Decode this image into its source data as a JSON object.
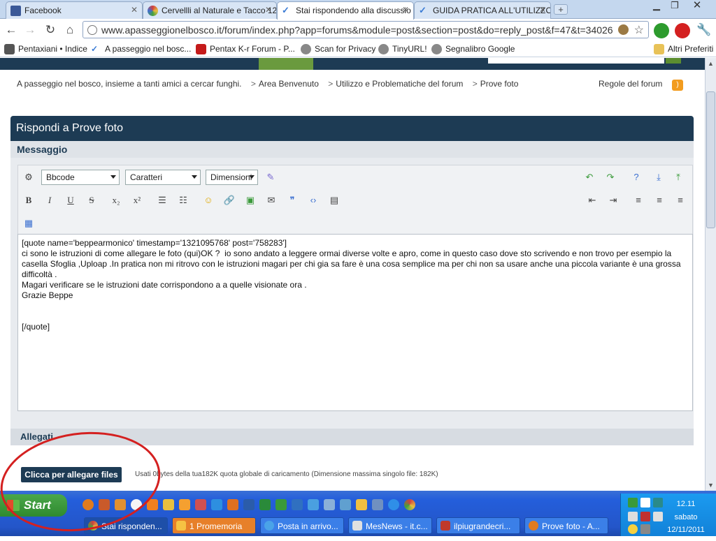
{
  "browser": {
    "tabs": [
      {
        "label": "Facebook",
        "color": "#3b5998"
      },
      {
        "label": "Cervellli al Naturale e Tacco 12",
        "color": "#d04040"
      },
      {
        "label": "Stai rispondendo alla discussio",
        "color": "#3a7bd5"
      },
      {
        "label": "GUIDA PRATICA ALL'UTILIZZO",
        "color": "#3a7bd5"
      }
    ],
    "url": "www.apasseggionelbosco.it/forum/index.php?app=forums&module=post&section=post&do=reply_post&f=47&t=34026",
    "bookmarks": [
      {
        "label": "Pentaxiani • Indice"
      },
      {
        "label": "A passeggio nel bosc..."
      },
      {
        "label": "Pentax K-r Forum - P..."
      },
      {
        "label": "Scan for Privacy"
      },
      {
        "label": "TinyURL!"
      },
      {
        "label": "Segnalibro Google"
      }
    ],
    "other_bookmarks": "Altri Preferiti"
  },
  "page": {
    "breadcrumbs": [
      "A passeggio nel bosco, insieme a tanti amici a cercar funghi.",
      "Area Benvenuto",
      "Utilizzo e Problematiche del forum",
      "Prove foto"
    ],
    "rules_link": "Regole del forum",
    "panel_title": "Rispondi a Prove foto",
    "section_title": "Messaggio",
    "editor": {
      "format_select": "Bbcode",
      "font_select": "Caratteri",
      "size_select": "Dimensioni",
      "content": "[quote name='beppearmonico' timestamp='1321095768' post='758283']\nci sono le istruzioni di come allegare le foto (qui)OK ?  io sono andato a leggere ormai diverse volte e apro, come in questo caso dove sto scrivendo e non trovo per esempio la casella Sfoglia ,Uploap .In pratica non mi ritrovo con le istruzioni magari per chi gia sa fare è una cosa semplice ma per chi non sa usare anche una piccola variante è una grossa difficoltà .\nMagari verificare se le istruzioni date corrispondono a a quelle visionate ora .\nGrazie Beppe\n\n\n[/quote]"
    },
    "attachments": {
      "title": "Allegati",
      "button": "Clicca per allegare files",
      "info": "Usati 0bytes della tua182K quota globale di caricamento (Dimensione massima singolo file: 182K)"
    }
  },
  "taskbar": {
    "start": "Start",
    "buttons": [
      {
        "label": "Stai risponden...",
        "color": "#ffffff"
      },
      {
        "label": "1 Promemoria",
        "color": "#f6c343"
      },
      {
        "label": "Posta in arrivo...",
        "color": "#4aa3e8"
      },
      {
        "label": "MesNews - it.c...",
        "color": "#e0e0e0"
      },
      {
        "label": "ilpiugrandecri...",
        "color": "#c0392b"
      },
      {
        "label": "Prove foto - A...",
        "color": "#e07b1f"
      }
    ],
    "clock": {
      "time": "12.11",
      "day": "sabato",
      "date": "12/11/2011"
    }
  }
}
